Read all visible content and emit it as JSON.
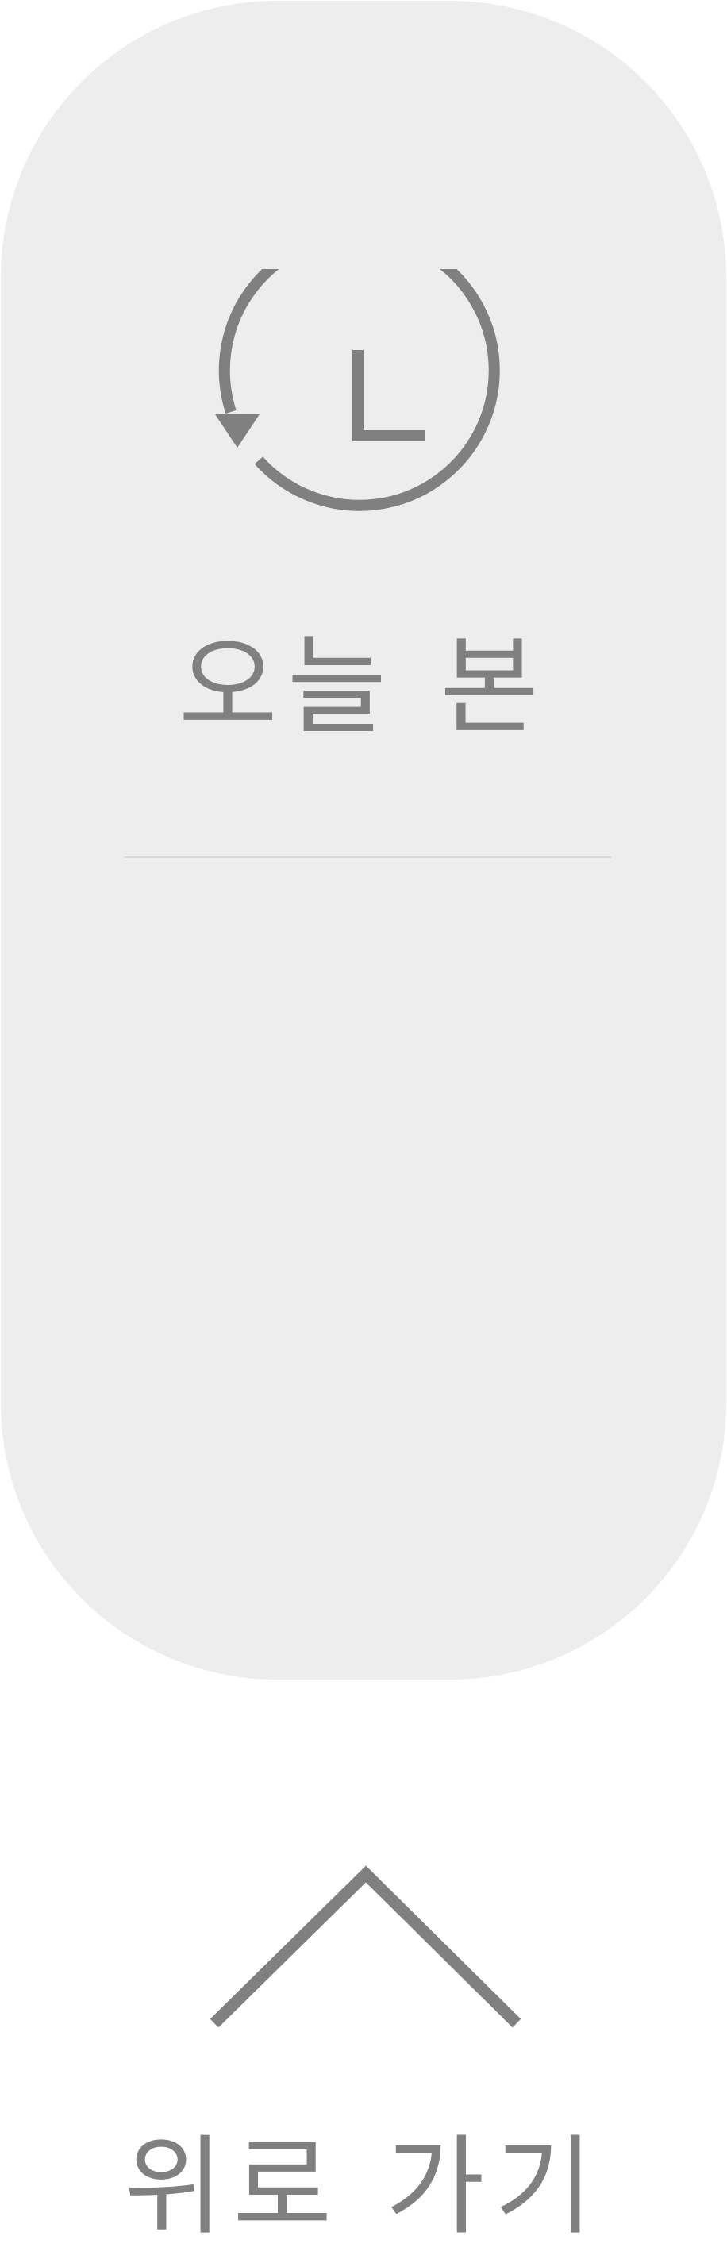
{
  "colors": {
    "panel_background": "#ededed",
    "foreground": "#808080",
    "divider": "#d9d9d9"
  },
  "recent_button": {
    "icon": "history-clock-icon",
    "label": "오늘 본"
  },
  "top_button": {
    "icon": "chevron-up-icon",
    "label": "위로 가기"
  }
}
